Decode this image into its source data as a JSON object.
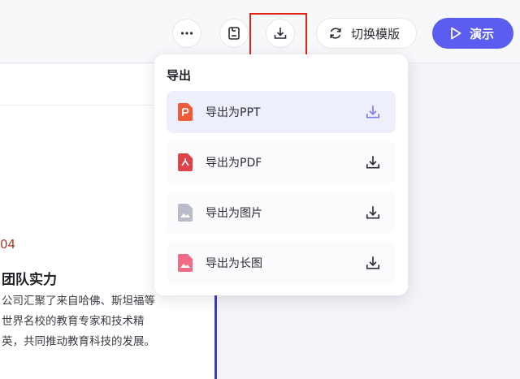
{
  "toolbar": {
    "more_icon": "ellipsis-icon",
    "save_icon": "save-icon",
    "download_icon": "download-icon",
    "switch_template_label": "切换模版",
    "present_label": "演示"
  },
  "slide": {
    "number": "04",
    "title": "团队实力",
    "description": "公司汇聚了来自哈佛、斯坦福等世界名校的教育专家和技术精英，共同推动教育科技的发展。"
  },
  "export_menu": {
    "title": "导出",
    "items": [
      {
        "label": "导出为PPT",
        "icon": "ppt-file-icon",
        "color": "#f15a3a"
      },
      {
        "label": "导出为PDF",
        "icon": "pdf-file-icon",
        "color": "#e0424b"
      },
      {
        "label": "导出为图片",
        "icon": "image-file-icon",
        "color": "#b8bcca"
      },
      {
        "label": "导出为长图",
        "icon": "long-image-file-icon",
        "color": "#f06b86"
      }
    ]
  },
  "colors": {
    "accent": "#5b5cf0",
    "highlight": "#e2231a"
  }
}
